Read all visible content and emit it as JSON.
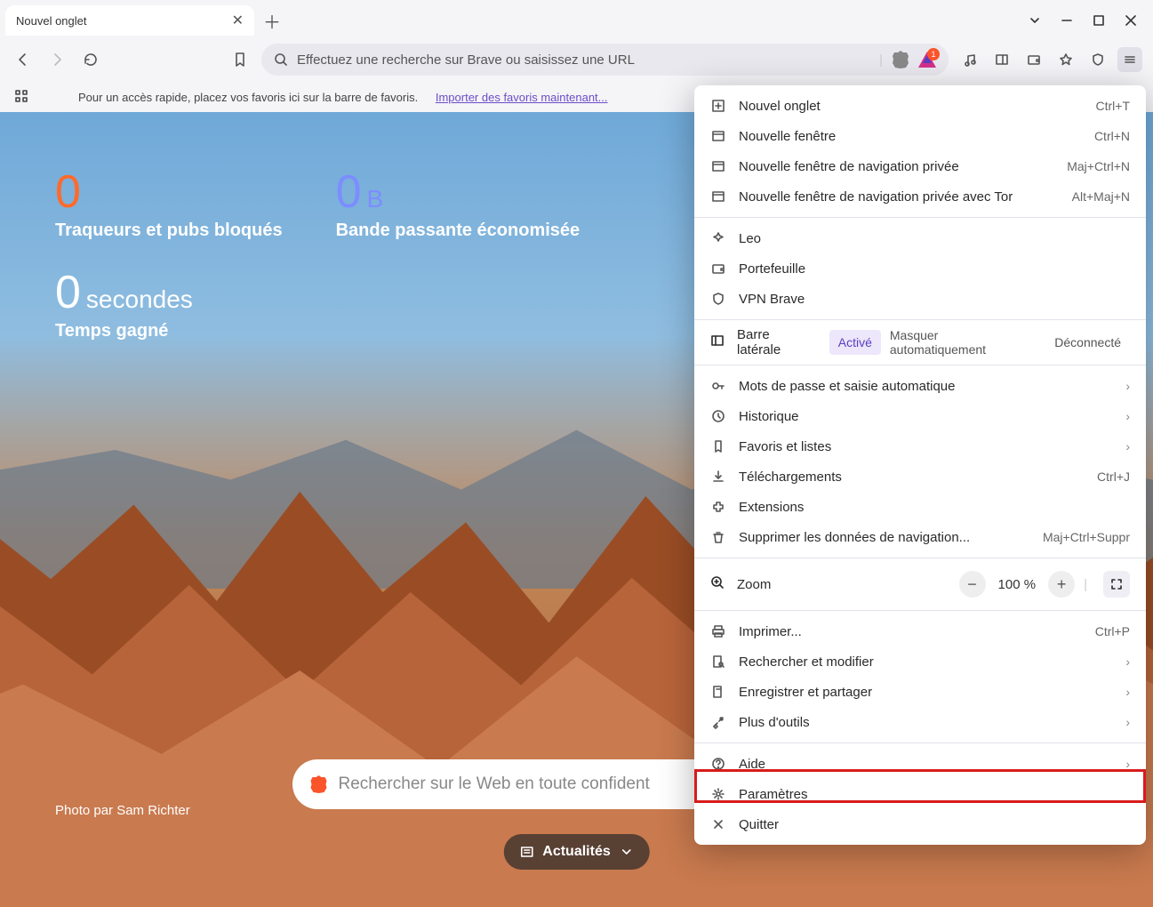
{
  "tab": {
    "title": "Nouvel onglet"
  },
  "urlbar": {
    "placeholder": "Effectuez une recherche sur Brave ou saisissez une URL"
  },
  "bookmarkbar": {
    "hint": "Pour un accès rapide, placez vos favoris ici sur la barre de favoris.",
    "import_link": "Importer des favoris maintenant..."
  },
  "stats": {
    "trackers": {
      "value": "0",
      "label": "Traqueurs et pubs bloqués"
    },
    "bandwidth": {
      "value": "0",
      "unit": "B",
      "label": "Bande passante économisée"
    },
    "time": {
      "value": "0",
      "unit": "secondes",
      "label": "Temps gagné"
    }
  },
  "photo_credit": "Photo par Sam Richter",
  "bottom_search_placeholder": "Rechercher sur le Web en toute confident",
  "news_button": "Actualités",
  "ext_badge": "1",
  "menu": {
    "new_tab": "Nouvel onglet",
    "new_tab_sc": "Ctrl+T",
    "new_window": "Nouvelle fenêtre",
    "new_window_sc": "Ctrl+N",
    "new_private": "Nouvelle fenêtre de navigation privée",
    "new_private_sc": "Maj+Ctrl+N",
    "new_tor": "Nouvelle fenêtre de navigation privée avec Tor",
    "new_tor_sc": "Alt+Maj+N",
    "leo": "Leo",
    "wallet": "Portefeuille",
    "vpn": "VPN Brave",
    "sidebar": "Barre latérale",
    "sidebar_opts": {
      "on": "Activé",
      "autohide": "Masquer automatiquement",
      "off": "Déconnecté"
    },
    "passwords": "Mots de passe et saisie automatique",
    "history": "Historique",
    "bookmarks": "Favoris et listes",
    "downloads": "Téléchargements",
    "downloads_sc": "Ctrl+J",
    "extensions": "Extensions",
    "clear_data": "Supprimer les données de navigation...",
    "clear_data_sc": "Maj+Ctrl+Suppr",
    "zoom": "Zoom",
    "zoom_value": "100 %",
    "print": "Imprimer...",
    "print_sc": "Ctrl+P",
    "find": "Rechercher et modifier",
    "save_share": "Enregistrer et partager",
    "more_tools": "Plus d'outils",
    "help": "Aide",
    "settings": "Paramètres",
    "quit": "Quitter"
  }
}
